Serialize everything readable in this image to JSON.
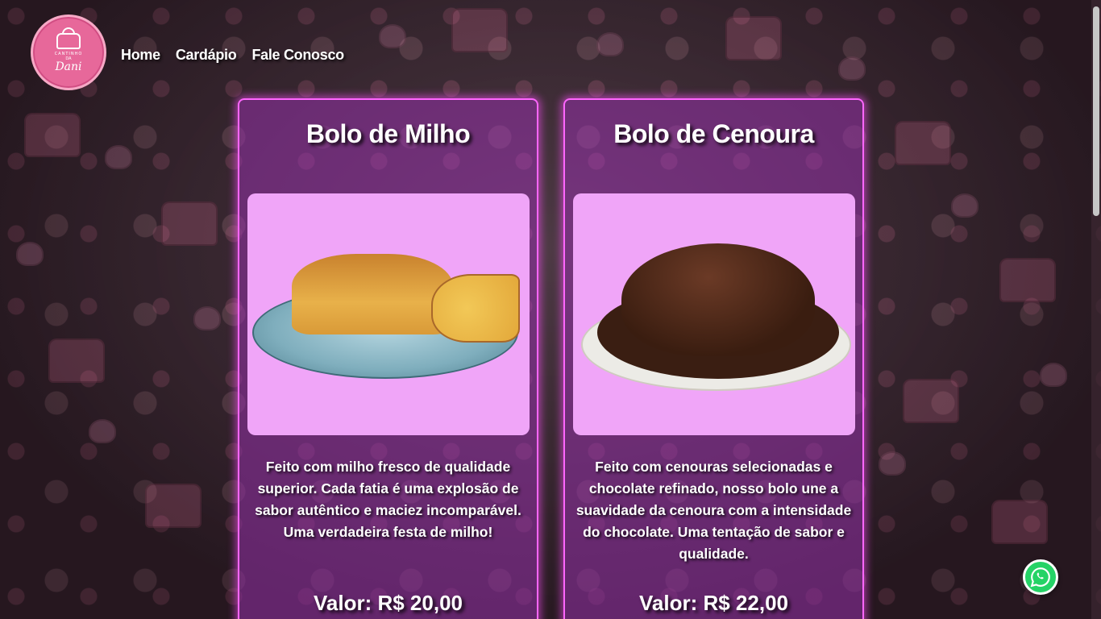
{
  "brand": {
    "logo_line1": "CANTINHO",
    "logo_line2": "DA",
    "logo_line3": "Dani"
  },
  "nav": {
    "items": [
      {
        "label": "Home"
      },
      {
        "label": "Cardápio"
      },
      {
        "label": "Fale Conosco"
      }
    ]
  },
  "cards": [
    {
      "title": "Bolo de Milho",
      "description": "Feito com milho fresco de qualidade superior. Cada fatia é uma explosão de sabor autêntico e maciez incomparável. Uma verdadeira festa de milho!",
      "price": "Valor: R$ 20,00"
    },
    {
      "title": "Bolo de Cenoura",
      "description": "Feito com cenouras selecionadas e chocolate refinado, nosso bolo une a suavidade da cenoura com a intensidade do chocolate. Uma tentação de sabor e qualidade.",
      "price": "Valor: R$ 22,00"
    }
  ],
  "icons": {
    "whatsapp": "whatsapp-icon"
  },
  "colors": {
    "card_border": "#ff66ff",
    "card_bg": "#9632aa",
    "photo_bg": "#f0a5f8",
    "logo_bg": "#e7689a",
    "whatsapp": "#25d366"
  }
}
